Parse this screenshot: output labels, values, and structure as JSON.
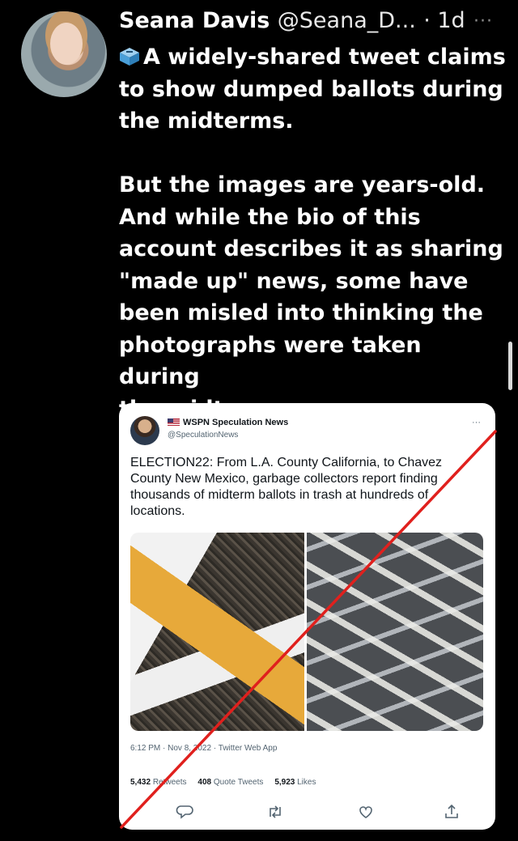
{
  "tweet": {
    "name": "Seana Davis",
    "handle": "@Seana_D...",
    "time": "· 1d",
    "more": "···",
    "text": "A widely-shared tweet claims\nto show dumped ballots during\nthe midterms.\n\nBut the images are years-old.\nAnd while the bio of this\naccount describes it as sharing\n\"made up\" news, some have\nbeen misled into thinking the\nphotographs were taken during\nthe midterms."
  },
  "embedded": {
    "name": "WSPN Speculation News",
    "handle": "@SpeculationNews",
    "more": "···",
    "text": "ELECTION22: From L.A. County California, to Chavez County New Mexico, garbage collectors report finding thousands of midterm ballots in trash at hundreds of locations.",
    "meta": "6:12 PM · Nov 8, 2022 · Twitter Web App",
    "retweets_count": "5,432",
    "retweets_label": "Retweets",
    "quotes_count": "408",
    "quotes_label": "Quote Tweets",
    "likes_count": "5,923",
    "likes_label": "Likes"
  },
  "icons": [
    "ballot-box-icon",
    "us-flag-icon",
    "reply-icon",
    "retweet-icon",
    "like-icon",
    "share-icon"
  ],
  "colors": {
    "background": "#000000",
    "card": "#ffffff",
    "slash": "#e0201d",
    "muted": "#536471"
  }
}
